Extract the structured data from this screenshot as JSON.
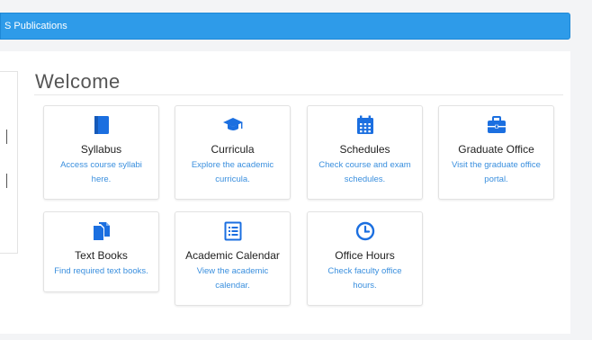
{
  "navbar": {
    "brand": "S Publications"
  },
  "page": {
    "title": "Welcome"
  },
  "colors": {
    "accent": "#2e9be9",
    "icon": "#1b6fe0",
    "link": "#3a8fde"
  },
  "cards": [
    {
      "id": "syllabus",
      "icon": "book-icon",
      "title": "Syllabus",
      "desc1": "Access course syllabi",
      "desc2": "here."
    },
    {
      "id": "curricula",
      "icon": "graduation-cap-icon",
      "title": "Curricula",
      "desc1": "Explore the academic",
      "desc2": "curricula."
    },
    {
      "id": "schedules",
      "icon": "calendar-icon",
      "title": "Schedules",
      "desc1": "Check course and exam",
      "desc2": "schedules."
    },
    {
      "id": "graduate-office",
      "icon": "briefcase-icon",
      "title": "Graduate Office",
      "desc1": "Visit the graduate office",
      "desc2": "portal."
    },
    {
      "id": "text-books",
      "icon": "file-copy-icon",
      "title": "Text Books",
      "desc1": "Find required text books.",
      "desc2": ""
    },
    {
      "id": "academic-calendar",
      "icon": "list-document-icon",
      "title": "Academic Calendar",
      "desc1": "View the academic",
      "desc2": "calendar."
    },
    {
      "id": "office-hours",
      "icon": "clock-icon",
      "title": "Office Hours",
      "desc1": "Check faculty office",
      "desc2": "hours."
    }
  ]
}
